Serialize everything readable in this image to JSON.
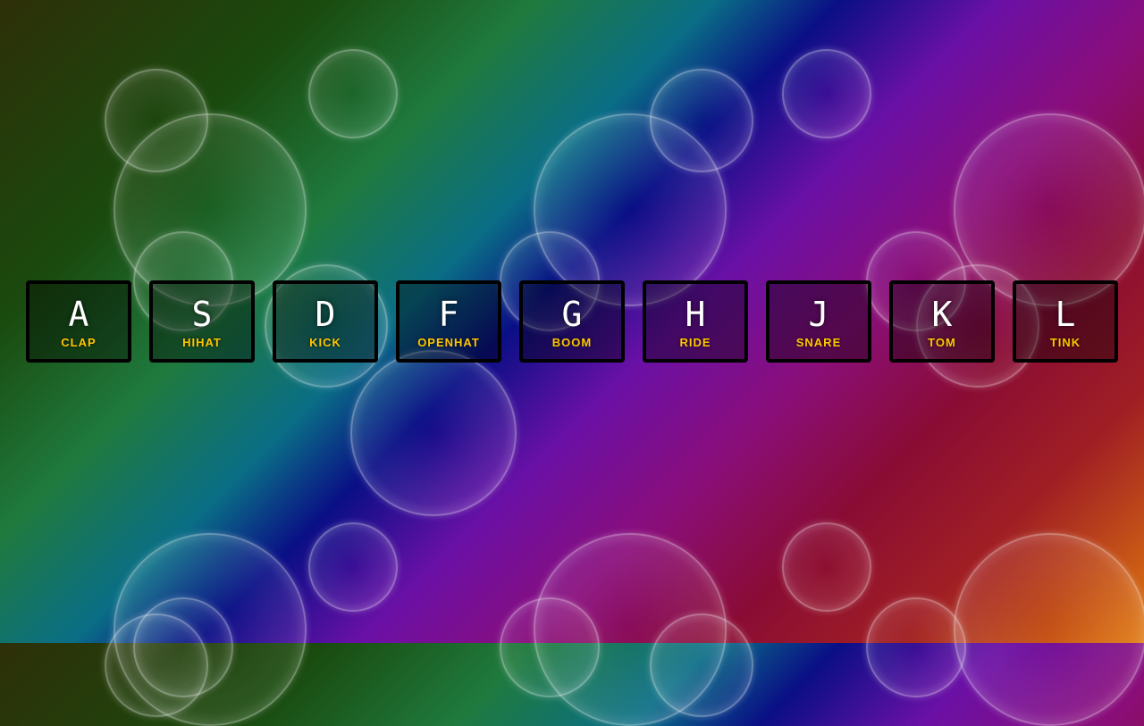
{
  "keys": [
    {
      "letter": "A",
      "sound": "CLAP"
    },
    {
      "letter": "S",
      "sound": "HIHAT"
    },
    {
      "letter": "D",
      "sound": "KICK"
    },
    {
      "letter": "F",
      "sound": "OPENHAT"
    },
    {
      "letter": "G",
      "sound": "BOOM"
    },
    {
      "letter": "H",
      "sound": "RIDE"
    },
    {
      "letter": "J",
      "sound": "SNARE"
    },
    {
      "letter": "K",
      "sound": "TOM"
    },
    {
      "letter": "L",
      "sound": "TINK"
    }
  ],
  "colors": {
    "label_accent": "#ffc600",
    "key_border": "#000000",
    "key_letter": "#ffffff"
  }
}
